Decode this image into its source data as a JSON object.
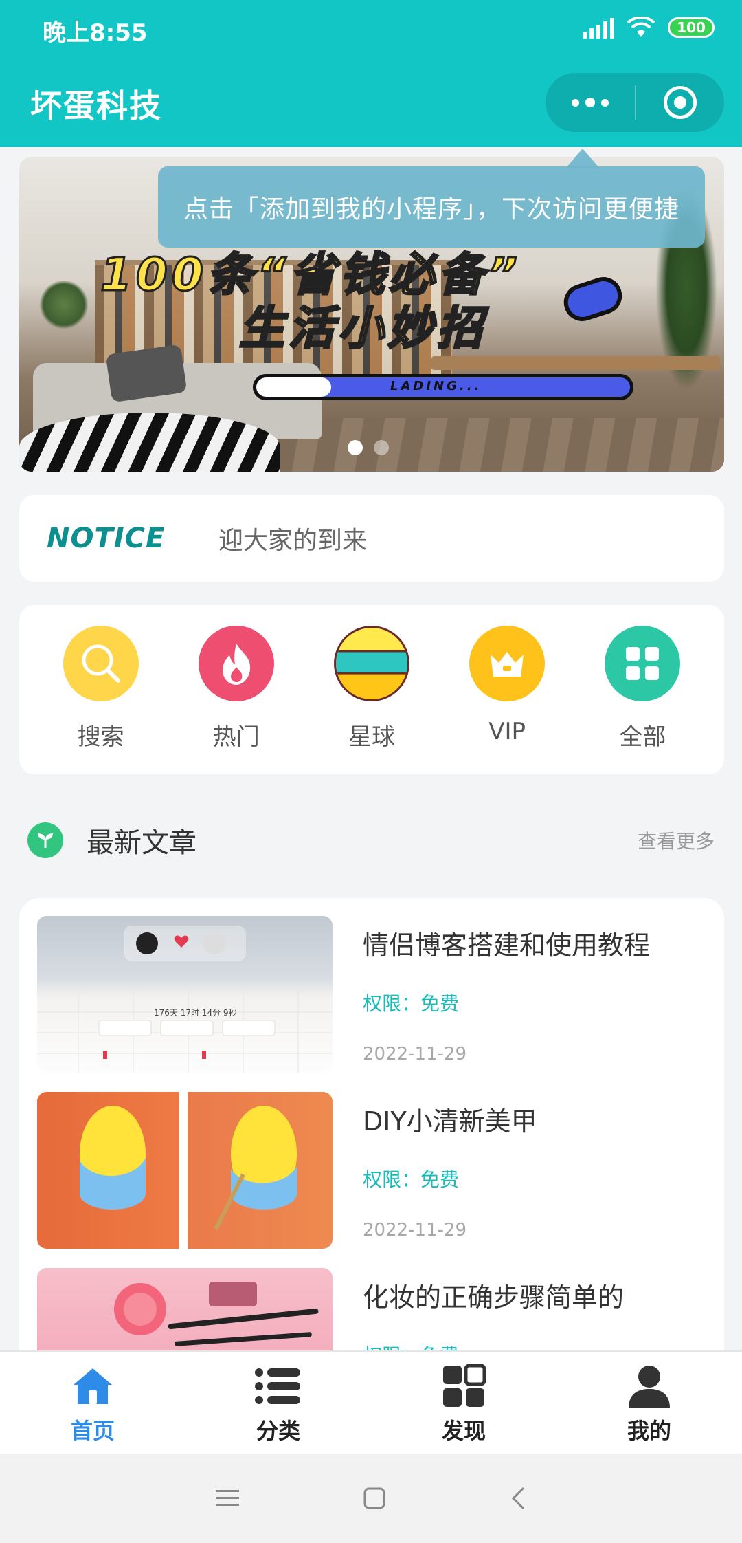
{
  "status_bar": {
    "time": "晚上8:55",
    "battery": "100"
  },
  "header": {
    "title": "坏蛋科技"
  },
  "banner": {
    "headline_line1": "100条“省钱必备”",
    "headline_line2": "生活小妙招",
    "loading_text": "LADING...",
    "loading_progress": 0.2,
    "slide_count": 2,
    "active_slide": 1
  },
  "tooltip": {
    "text": "点击「添加到我的小程序」，下次访问更便捷"
  },
  "notice": {
    "logo_text": "NOTICE",
    "text": "迎大家的到来"
  },
  "nav": {
    "items": [
      {
        "label": "搜索",
        "icon": "search-icon"
      },
      {
        "label": "热门",
        "icon": "fire-icon"
      },
      {
        "label": "星球",
        "icon": "planet-icon"
      },
      {
        "label": "VIP",
        "icon": "crown-icon"
      },
      {
        "label": "全部",
        "icon": "grid-icon"
      }
    ]
  },
  "section": {
    "title": "最新文章",
    "more": "查看更多"
  },
  "articles": [
    {
      "title": "情侣博客搭建和使用教程",
      "permission": "权限：免费",
      "date": "2022-11-29",
      "thumb_caption": "176天 17时 14分 9秒"
    },
    {
      "title": "DIY小清新美甲",
      "permission": "权限：免费",
      "date": "2022-11-29"
    },
    {
      "title": "化妆的正确步骤简单的",
      "permission": "权限：免费",
      "date": ""
    }
  ],
  "tabbar": {
    "items": [
      {
        "label": "首页",
        "icon": "home-icon",
        "active": true
      },
      {
        "label": "分类",
        "icon": "list-icon",
        "active": false
      },
      {
        "label": "发现",
        "icon": "discover-grid-icon",
        "active": false
      },
      {
        "label": "我的",
        "icon": "user-icon",
        "active": false
      }
    ]
  },
  "colors": {
    "brand": "#12c6c6",
    "active_tab": "#2f8be8",
    "permission": "#18bcbc"
  }
}
